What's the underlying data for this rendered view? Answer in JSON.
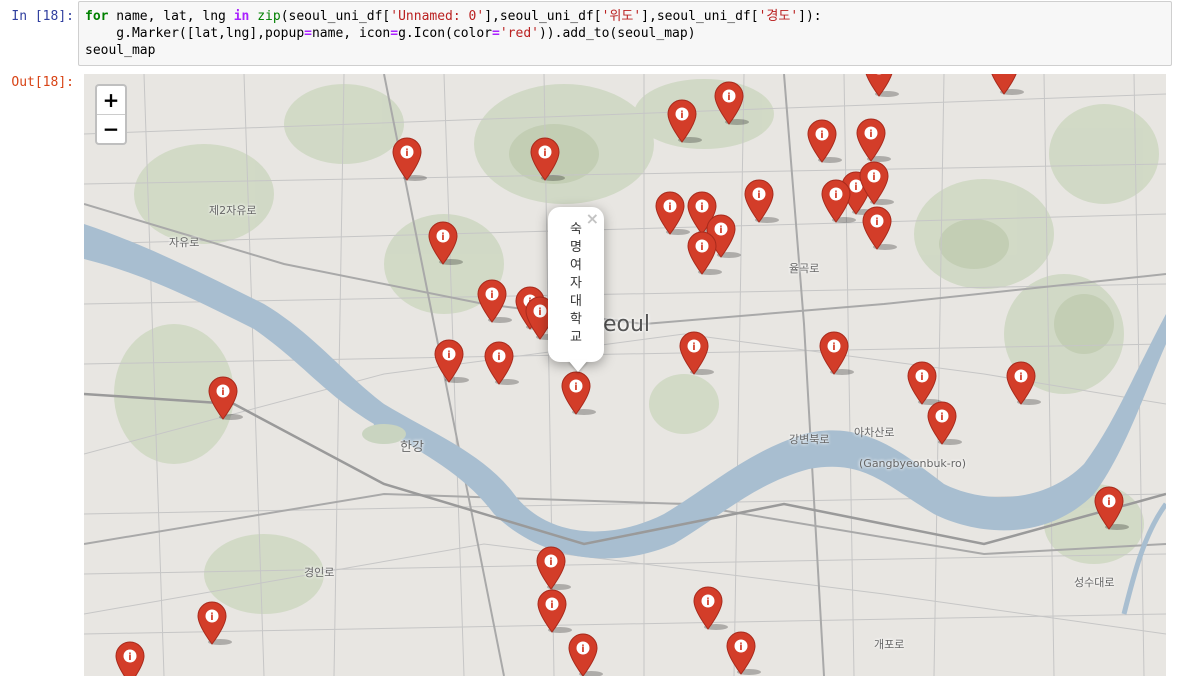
{
  "cell": {
    "in_prompt": "In [18]:",
    "out_prompt": "Out[18]:"
  },
  "map": {
    "zoom_in": "+",
    "zoom_out": "−",
    "popup_text": "숙명여자대학교",
    "popup_close": "×",
    "labels": {
      "seoul": "Seoul",
      "han_river": "한강",
      "gangbyeon": "(Gangbyeonbuk-ro)",
      "gangbyeonbukro": "강변북로",
      "ring_road": "제2자유로",
      "jayuro": "자유로",
      "yulgokro": "율곡로",
      "aricha": "아차산로",
      "gaepo": "개포로",
      "gyeongin": "경인로",
      "seongsu": "성수대로"
    },
    "marker_color": "#d33d29"
  }
}
